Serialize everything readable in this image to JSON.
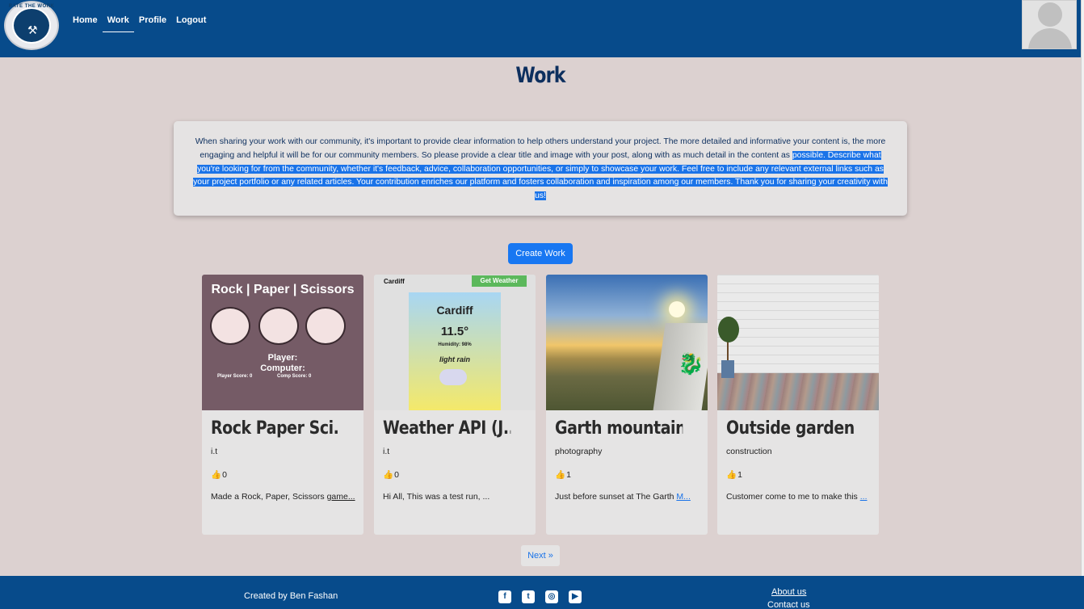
{
  "header": {
    "logo_text": "RATE THE WORK",
    "nav": [
      {
        "label": "Home"
      },
      {
        "label": "Work"
      },
      {
        "label": "Profile"
      },
      {
        "label": "Logout"
      }
    ],
    "active_nav": "Work"
  },
  "page": {
    "title": "Work",
    "info_plain": "When sharing your work with our community, it's important to provide clear information to help others understand your project. The more detailed and informative your content is, the more engaging and helpful it will be for our community members. So please provide a clear title and image with your post, along with as much detail in the content as ",
    "info_selected": "possible. Describe what you're looking for from the community, whether it's feedback, advice, collaboration opportunities, or simply to showcase your work. Feel free to include any relevant external links such as your project portfolio or any related articles. Your contribution enriches our platform and fosters collaboration and inspiration among our members. Thank you for sharing your creativity with us!",
    "create_button": "Create Work"
  },
  "cards": [
    {
      "title": "Rock Paper Sci...",
      "category": "i.t",
      "likes": "0",
      "description": "Made a Rock, Paper, Scissors ",
      "more": "game...",
      "image": {
        "title": "Rock | Paper | Scissors",
        "player": "Player:",
        "computer": "Computer:",
        "player_score": "Player Score: 0",
        "comp_score": "Comp Score: 0"
      }
    },
    {
      "title": "Weather API (J...",
      "category": "i.t",
      "likes": "0",
      "description": "Hi All, This was a test run, ...",
      "more": "",
      "image": {
        "city_label": "Cardiff",
        "button": "Get Weather",
        "city": "Cardiff",
        "temp": "11.5°",
        "humidity": "Humidity: 98%",
        "condition": "light rain"
      }
    },
    {
      "title": "Garth mountain",
      "category": "photography",
      "likes": "1",
      "description": "Just before sunset at The Garth ",
      "more": "M..."
    },
    {
      "title": "Outside garden",
      "category": "construction",
      "likes": "1",
      "description": "Customer come to me to make this ",
      "more": "..."
    }
  ],
  "pagination": {
    "next": "Next »"
  },
  "footer": {
    "credit": "Created by Ben Fashan",
    "socials": [
      "facebook-icon",
      "twitter-icon",
      "instagram-icon",
      "youtube-icon"
    ],
    "about": "About us",
    "contact": "Contact us"
  },
  "colors": {
    "nav_bg": "#074b8b",
    "page_bg": "#dcd1d0",
    "accent": "#1877f2"
  }
}
